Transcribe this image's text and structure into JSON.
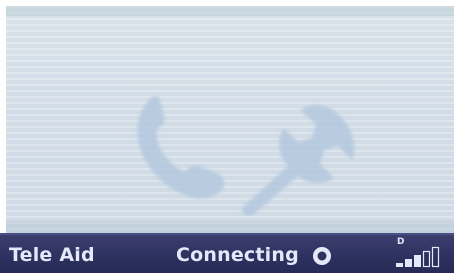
{
  "status_bar": {
    "left_label": "Tele Aid",
    "center_label": "Connecting",
    "signal": {
      "letter": "D",
      "bars_total": 5,
      "bars_filled": 3
    },
    "radio_icon": "radio-button-icon"
  },
  "display": {
    "watermark_icons": [
      "phone-handset-icon",
      "wrench-icon"
    ]
  },
  "colors": {
    "status_bar_bg": "#2e3260",
    "status_text": "#e4e8f8",
    "display_bg": "#d8e2ea",
    "watermark": "#b7cbe0"
  }
}
